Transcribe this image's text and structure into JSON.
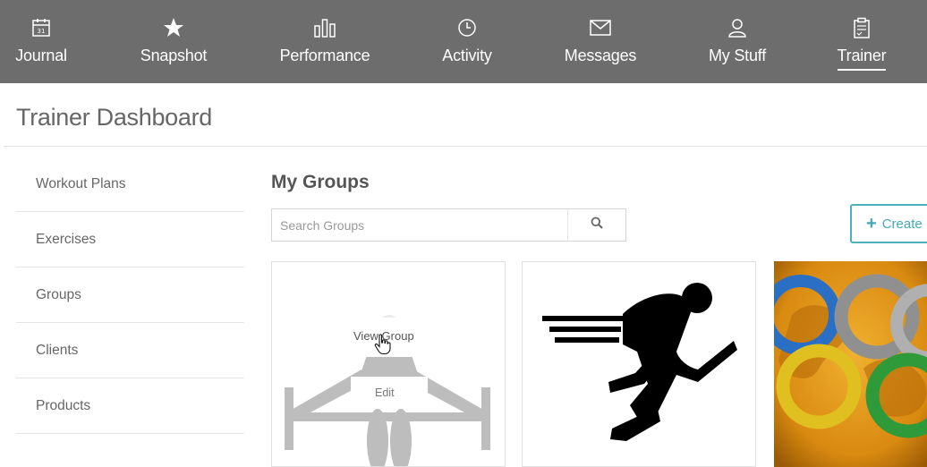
{
  "nav": {
    "items": [
      {
        "label": "Journal",
        "icon": "calendar-icon",
        "icon_text": "31"
      },
      {
        "label": "Snapshot",
        "icon": "star-icon"
      },
      {
        "label": "Performance",
        "icon": "bar-chart-icon"
      },
      {
        "label": "Activity",
        "icon": "clock-icon"
      },
      {
        "label": "Messages",
        "icon": "envelope-icon"
      },
      {
        "label": "My Stuff",
        "icon": "user-icon"
      },
      {
        "label": "Trainer",
        "icon": "clipboard-icon",
        "active": true
      }
    ]
  },
  "page": {
    "title": "Trainer Dashboard"
  },
  "sidebar": {
    "items": [
      {
        "label": "Workout Plans"
      },
      {
        "label": "Exercises"
      },
      {
        "label": "Groups"
      },
      {
        "label": "Clients"
      },
      {
        "label": "Products"
      }
    ]
  },
  "groups": {
    "title": "My Groups",
    "search_placeholder": "Search Groups",
    "create_label": "Create N",
    "cards": [
      {
        "view_label": "View Group",
        "edit_label": "Edit",
        "image": "weightlifter-placeholder"
      },
      {
        "image": "running-man"
      },
      {
        "image": "olympic-rings-globe"
      }
    ]
  },
  "colors": {
    "nav_bg": "#6d6d6d",
    "accent": "#45a9b6"
  }
}
